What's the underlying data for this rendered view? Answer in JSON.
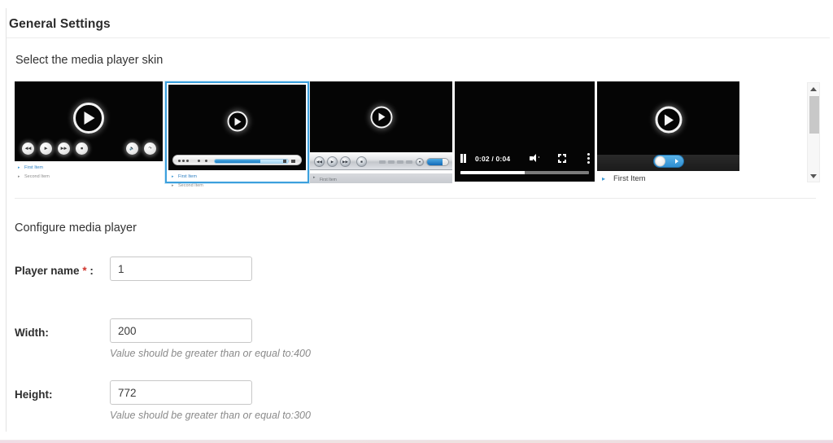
{
  "page": {
    "title": "General Settings"
  },
  "sections": {
    "skins": {
      "title": "Select the media player skin"
    },
    "configure": {
      "title": "Configure media player"
    }
  },
  "skins": [
    {
      "name": "classic-round-buttons-skin",
      "selected": false,
      "playlist": [
        "First Item",
        "Second Item"
      ],
      "controls": [
        "rewind",
        "play",
        "forward",
        "stop",
        "volume",
        "loop"
      ]
    },
    {
      "name": "slim-glass-bar-skin",
      "selected": true,
      "playlist": [
        "First Item",
        "Second Item"
      ],
      "controls": [
        "prev",
        "play",
        "next",
        "mute",
        "playlist",
        "progress",
        "volume",
        "fullscreen"
      ]
    },
    {
      "name": "silver-chrome-skin",
      "selected": false,
      "playlist": [
        "First Item"
      ],
      "controls": [
        "rewind",
        "play",
        "forward",
        "stop",
        "time",
        "volume-icon",
        "volume-slider"
      ]
    },
    {
      "name": "html5-native-skin",
      "selected": false,
      "playlist": [],
      "time_display": "0:02 / 0:04",
      "controls": [
        "pause",
        "time",
        "volume",
        "fullscreen",
        "more-options"
      ],
      "progress_percent": 50
    },
    {
      "name": "toggle-switch-skin",
      "selected": false,
      "playlist": [
        "First Item"
      ],
      "controls": [
        "play-toggle"
      ]
    }
  ],
  "scrollbar": {
    "up_label": "Scroll up",
    "down_label": "Scroll down"
  },
  "form": {
    "fields": [
      {
        "label": "Player name",
        "required": true,
        "colon": " :",
        "value": "1",
        "placeholder": "",
        "hint": ""
      },
      {
        "label": "Width:",
        "required": false,
        "colon": "",
        "value": "200",
        "placeholder": "",
        "hint": "Value should be greater than or equal to:400"
      },
      {
        "label": "Height:",
        "required": false,
        "colon": "",
        "value": "772",
        "placeholder": "",
        "hint": "Value should be greater than or equal to:300"
      }
    ]
  },
  "colors": {
    "accent": "#3ca0dd",
    "link": "#2d7fc1",
    "required": "#d0342c",
    "hint": "#8a8a8a",
    "screen": "#050505"
  }
}
